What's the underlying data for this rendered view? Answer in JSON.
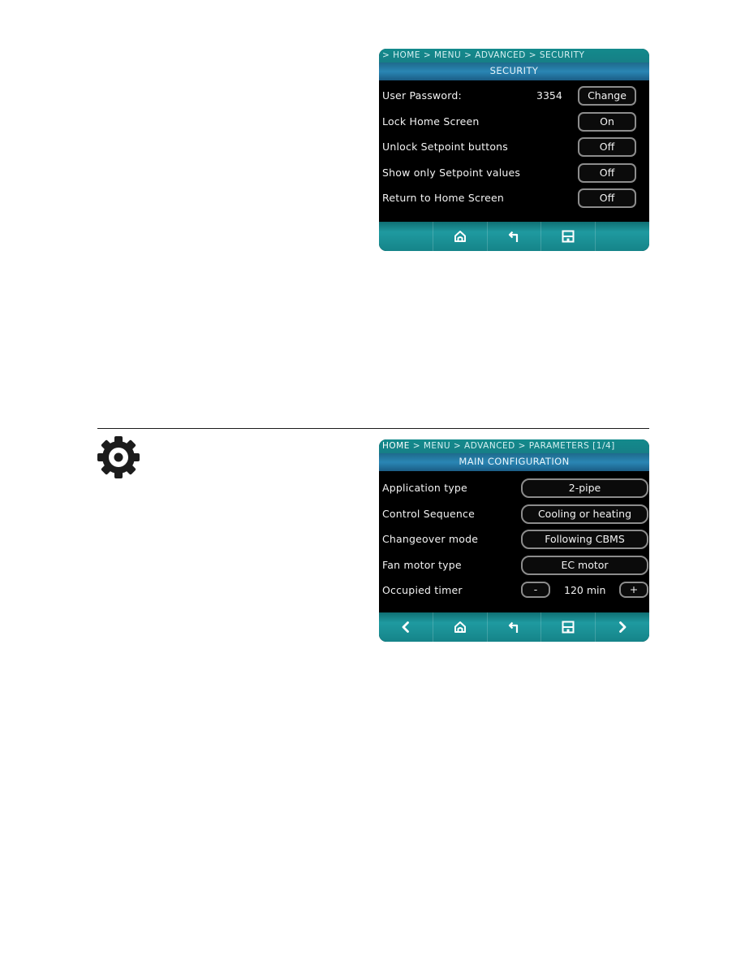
{
  "security_screen": {
    "breadcrumb": [
      "> HOME",
      "> MENU",
      "> ADVANCED",
      "> SECURITY"
    ],
    "title": "SECURITY",
    "rows": [
      {
        "label": "User Password:",
        "value": "3354",
        "button": "Change"
      },
      {
        "label": "Lock Home Screen",
        "button": "On"
      },
      {
        "label": "Unlock Setpoint buttons",
        "button": "Off"
      },
      {
        "label": "Show only Setpoint values",
        "button": "Off"
      },
      {
        "label": "Return to Home Screen",
        "button": "Off"
      }
    ],
    "nav": [
      "",
      "home-icon",
      "back-icon",
      "save-icon",
      ""
    ]
  },
  "parameters_screen": {
    "breadcrumb": [
      "HOME",
      "> MENU",
      "> ADVANCED",
      "> PARAMETERS [1/4]"
    ],
    "title": "MAIN CONFIGURATION",
    "rows": [
      {
        "label": "Application type",
        "button": "2-pipe"
      },
      {
        "label": "Control Sequence",
        "button": "Cooling or heating"
      },
      {
        "label": "Changeover mode",
        "button": "Following CBMS"
      },
      {
        "label": "Fan motor type",
        "button": "EC motor"
      },
      {
        "label": "Occupied timer",
        "minus": "-",
        "value": "120 min",
        "plus": "+"
      }
    ],
    "nav": [
      "previous-icon",
      "home-icon",
      "back-icon",
      "save-icon",
      "next-icon"
    ]
  },
  "section_icon": "gear-icon"
}
